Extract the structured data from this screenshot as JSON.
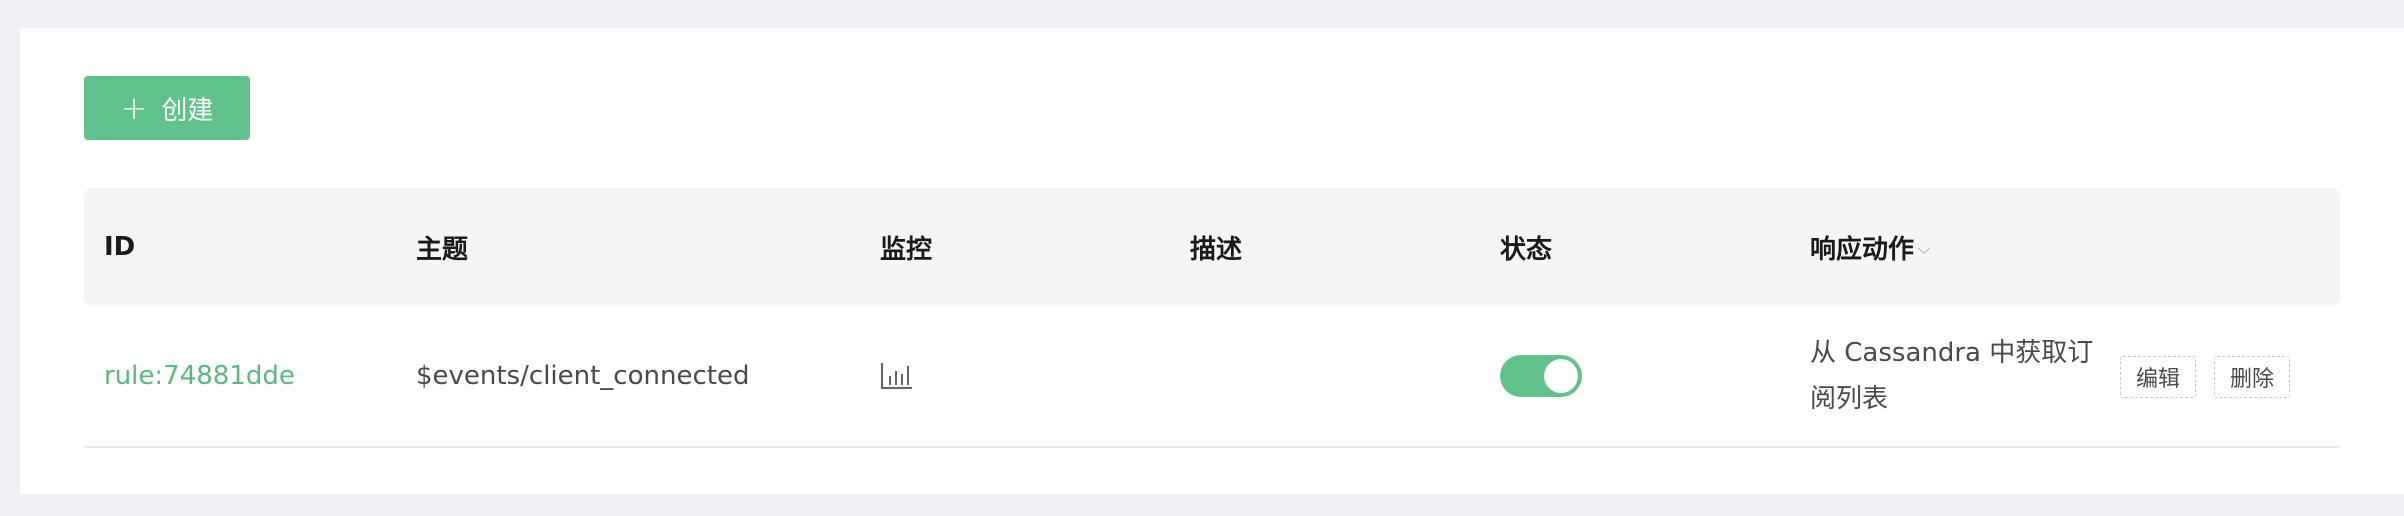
{
  "toolbar": {
    "create_label": "创建"
  },
  "table": {
    "columns": {
      "id": "ID",
      "topic": "主题",
      "monitor": "监控",
      "description": "描述",
      "status": "状态",
      "actions": "响应动作"
    },
    "rows": [
      {
        "id": "rule:74881dde",
        "topic": "$events/client_connected",
        "description": "",
        "status_enabled": true,
        "actions": "从 Cassandra 中获取订阅列表",
        "edit_label": "编辑",
        "delete_label": "删除"
      }
    ]
  },
  "colors": {
    "accent": "#61c38b",
    "link": "#5cb87f",
    "background": "#eff1f4"
  },
  "icons": {
    "create": "plus-icon",
    "monitor": "bar-chart-icon",
    "sort": "chevron-down-icon"
  }
}
